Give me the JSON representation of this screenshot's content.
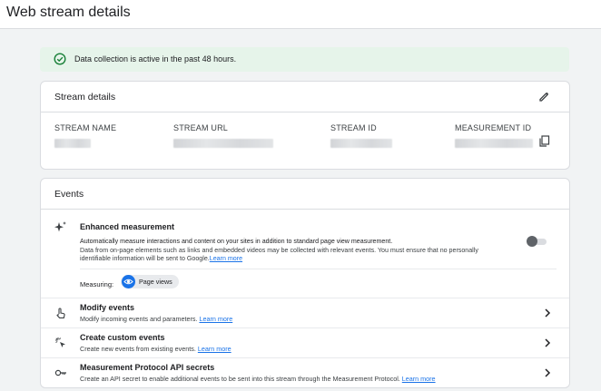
{
  "page": {
    "title": "Web stream details"
  },
  "banner": {
    "text": "Data collection is active in the past 48 hours.",
    "color": "#e6f4ea",
    "icon": "check-circle-icon"
  },
  "stream_details": {
    "title": "Stream details",
    "columns": [
      {
        "label": "STREAM NAME"
      },
      {
        "label": "STREAM URL"
      },
      {
        "label": "STREAM ID"
      },
      {
        "label": "MEASUREMENT ID"
      }
    ]
  },
  "events": {
    "title": "Events",
    "enhanced": {
      "title": "Enhanced measurement",
      "line1": "Automatically measure interactions and content on your sites in addition to standard page view measurement.",
      "line2": "Data from on-page elements such as links and embedded videos may be collected with relevant events. You must ensure that no personally",
      "line3": "identifiable information will be sent to Google.",
      "learn_more": "Learn more",
      "toggle_on": false,
      "measuring_label": "Measuring:",
      "chip_label": "Page views"
    },
    "rows": [
      {
        "title": "Modify events",
        "sub": "Modify incoming events and parameters.",
        "learn_more": "Learn more",
        "icon": "touch-icon"
      },
      {
        "title": "Create custom events",
        "sub": "Create new events from existing events.",
        "learn_more": "Learn more",
        "icon": "sparkle-click-icon"
      },
      {
        "title": "Measurement Protocol API secrets",
        "sub": "Create an API secret to enable additional events to be sent into this stream through the Measurement Protocol.",
        "learn_more": "Learn more",
        "icon": "key-icon"
      }
    ]
  },
  "colors": {
    "accent": "#1a73e8",
    "success_bg": "#e6f4ea",
    "success_icon": "#188038"
  }
}
